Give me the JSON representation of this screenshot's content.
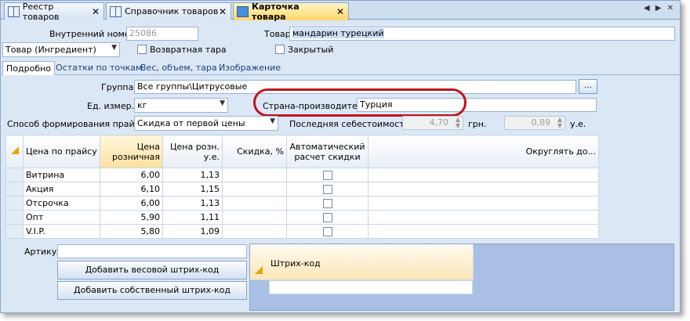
{
  "tabs": [
    {
      "label": "Реестр товаров",
      "active": false
    },
    {
      "label": "Справочник товаров",
      "active": false
    },
    {
      "label": "Карточка товара",
      "active": true
    }
  ],
  "tab_nav": "◀ ▶ ✕",
  "header": {
    "internal_number_label": "Внутренний номер",
    "internal_number_value": "25086",
    "product_label": "Товар",
    "product_value": "мандарин турецкий",
    "type_value": "Товар (Ингредиент)",
    "returnable_label": "Возвратная тара",
    "closed_label": "Закрытый"
  },
  "subtabs": [
    "Подробно",
    "Остатки по точкам",
    "Вес, объем, тара",
    "Изображение"
  ],
  "form": {
    "group_label": "Группа",
    "group_value": "Все группы\\Цитрусовые",
    "group_btn": "...",
    "unit_label": "Ед. измер.",
    "unit_value": "кг",
    "country_label": "Страна-производитель:",
    "country_value": "Турция",
    "price_method_label": "Способ формирования прайса",
    "price_method_value": "Скидка от первой цены",
    "last_cost_label": "Последняя себестоимость",
    "last_cost_value": "4,70",
    "currency1": "грн.",
    "cost2_value": "0,89",
    "currency2": "у.е."
  },
  "grid": {
    "columns": [
      "Цена по прайсу",
      "Цена розничная",
      "Цена розн. у.е.",
      "Скидка, %",
      "Автоматический расчет скидки",
      "Округлять до..."
    ],
    "rows": [
      {
        "name": "Витрина",
        "retail": "6,00",
        "retail_ue": "1,13"
      },
      {
        "name": "Акция",
        "retail": "6,10",
        "retail_ue": "1,15"
      },
      {
        "name": "Отсрочка",
        "retail": "6,00",
        "retail_ue": "1,13"
      },
      {
        "name": "Опт",
        "retail": "5,90",
        "retail_ue": "1,11"
      },
      {
        "name": "V.I.P.",
        "retail": "5,80",
        "retail_ue": "1,09"
      }
    ]
  },
  "bottom": {
    "article_label": "Артикул",
    "add_weight_barcode": "Добавить весовой штрих-код",
    "add_own_barcode": "Добавить собственный штрих-код",
    "barcode_header": "Штрих-код"
  }
}
